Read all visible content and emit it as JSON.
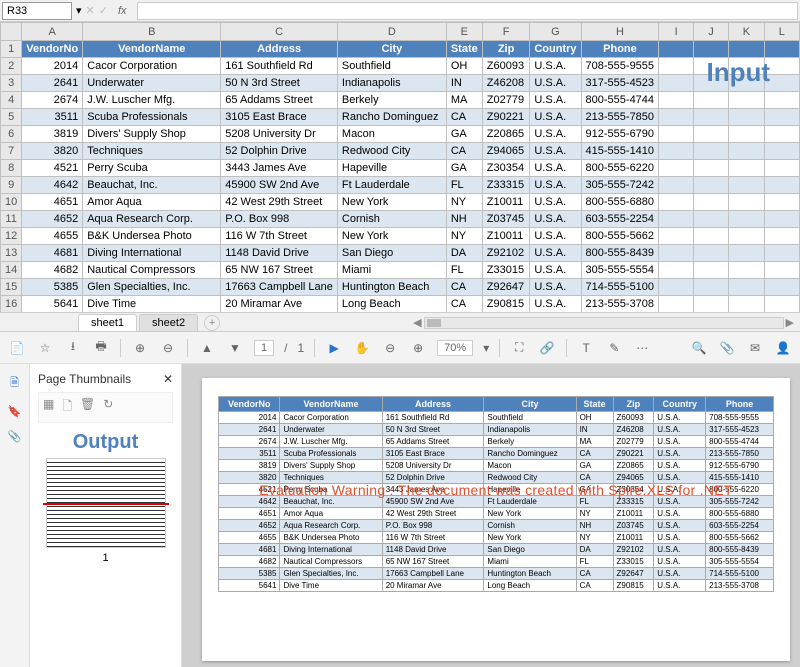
{
  "cell_ref": "R33",
  "fx_label": "fx",
  "input_label": "Input",
  "output_label": "Output",
  "sheet_tabs": [
    "sheet1",
    "sheet2"
  ],
  "col_letters": [
    "A",
    "B",
    "C",
    "D",
    "E",
    "F",
    "G",
    "H",
    "I",
    "J",
    "K",
    "L"
  ],
  "headers": [
    "VendorNo",
    "VendorName",
    "Address",
    "City",
    "State",
    "Zip",
    "Country",
    "Phone"
  ],
  "rows": [
    {
      "no": "2014",
      "name": "Cacor Corporation",
      "addr": "161 Southfield Rd",
      "city": "Southfield",
      "state": "OH",
      "zip": "Z60093",
      "country": "U.S.A.",
      "phone": "708-555-9555"
    },
    {
      "no": "2641",
      "name": "Underwater",
      "addr": "50 N 3rd Street",
      "city": "Indianapolis",
      "state": "IN",
      "zip": "Z46208",
      "country": "U.S.A.",
      "phone": "317-555-4523"
    },
    {
      "no": "2674",
      "name": "J.W.  Luscher Mfg.",
      "addr": "65 Addams Street",
      "city": "Berkely",
      "state": "MA",
      "zip": "Z02779",
      "country": "U.S.A.",
      "phone": "800-555-4744"
    },
    {
      "no": "3511",
      "name": "Scuba Professionals",
      "addr": "3105 East Brace",
      "city": "Rancho Dominguez",
      "state": "CA",
      "zip": "Z90221",
      "country": "U.S.A.",
      "phone": "213-555-7850"
    },
    {
      "no": "3819",
      "name": "Divers'  Supply Shop",
      "addr": "5208 University Dr",
      "city": "Macon",
      "state": "GA",
      "zip": "Z20865",
      "country": "U.S.A.",
      "phone": "912-555-6790"
    },
    {
      "no": "3820",
      "name": "Techniques",
      "addr": "52 Dolphin Drive",
      "city": "Redwood City",
      "state": "CA",
      "zip": "Z94065",
      "country": "U.S.A.",
      "phone": "415-555-1410"
    },
    {
      "no": "4521",
      "name": "Perry Scuba",
      "addr": "3443 James Ave",
      "city": "Hapeville",
      "state": "GA",
      "zip": "Z30354",
      "country": "U.S.A.",
      "phone": "800-555-6220"
    },
    {
      "no": "4642",
      "name": "Beauchat, Inc.",
      "addr": "45900 SW 2nd Ave",
      "city": "Ft Lauderdale",
      "state": "FL",
      "zip": "Z33315",
      "country": "U.S.A.",
      "phone": "305-555-7242"
    },
    {
      "no": "4651",
      "name": "Amor Aqua",
      "addr": "42 West 29th Street",
      "city": "New York",
      "state": "NY",
      "zip": "Z10011",
      "country": "U.S.A.",
      "phone": "800-555-6880"
    },
    {
      "no": "4652",
      "name": "Aqua Research Corp.",
      "addr": "P.O. Box 998",
      "city": "Cornish",
      "state": "NH",
      "zip": "Z03745",
      "country": "U.S.A.",
      "phone": "603-555-2254"
    },
    {
      "no": "4655",
      "name": "B&K Undersea Photo",
      "addr": "116 W 7th Street",
      "city": "New York",
      "state": "NY",
      "zip": "Z10011",
      "country": "U.S.A.",
      "phone": "800-555-5662"
    },
    {
      "no": "4681",
      "name": "Diving International",
      "addr": "1148 David Drive",
      "city": "San Diego",
      "state": "DA",
      "zip": "Z92102",
      "country": "U.S.A.",
      "phone": "800-555-8439"
    },
    {
      "no": "4682",
      "name": "Nautical Compressors",
      "addr": "65 NW 167 Street",
      "city": "Miami",
      "state": "FL",
      "zip": "Z33015",
      "country": "U.S.A.",
      "phone": "305-555-5554"
    },
    {
      "no": "5385",
      "name": "Glen Specialties, Inc.",
      "addr": "17663 Campbell Lane",
      "city": "Huntington Beach",
      "state": "CA",
      "zip": "Z92647",
      "country": "U.S.A.",
      "phone": "714-555-5100"
    },
    {
      "no": "5641",
      "name": "Dive Time",
      "addr": "20 Miramar Ave",
      "city": "Long Beach",
      "state": "CA",
      "zip": "Z90815",
      "country": "U.S.A.",
      "phone": "213-555-3708"
    }
  ],
  "pdf": {
    "thumbs_title": "Page Thumbnails",
    "page_current": "1",
    "page_sep": "/",
    "page_total": "1",
    "zoom": "70%",
    "thumb_number": "1",
    "eval_warning": "Evaluation Warning : The document was created with  Spire.XLS for .NET"
  }
}
